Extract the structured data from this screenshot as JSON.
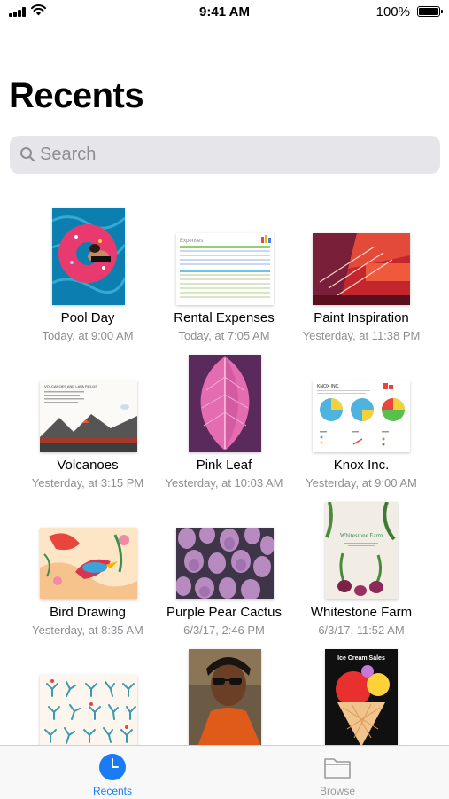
{
  "status_bar": {
    "time": "9:41 AM",
    "battery_percent": "100%"
  },
  "page_title": "Recents",
  "search": {
    "placeholder": "Search"
  },
  "documents": [
    {
      "name": "Pool Day",
      "date": "Today, at 9:00 AM"
    },
    {
      "name": "Rental Expenses",
      "date": "Today, at 7:05 AM",
      "thumb_title": "Expenses"
    },
    {
      "name": "Paint Inspiration",
      "date": "Yesterday, at 11:38 PM"
    },
    {
      "name": "Volcanoes",
      "date": "Yesterday, at 3:15 PM",
      "thumb_title": "VOLCANOES AND LAVA FIELDS"
    },
    {
      "name": "Pink Leaf",
      "date": "Yesterday, at 10:03 AM"
    },
    {
      "name": "Knox Inc.",
      "date": "Yesterday, at 9:00 AM",
      "thumb_title": "KNOX INC."
    },
    {
      "name": "Bird Drawing",
      "date": "Yesterday, at 8:35 AM"
    },
    {
      "name": "Purple Pear Cactus",
      "date": "6/3/17, 2:46 PM"
    },
    {
      "name": "Whitestone Farm",
      "date": "6/3/17, 11:52 AM",
      "thumb_title": "Whitestone Farm"
    },
    {
      "name": "",
      "date": ""
    },
    {
      "name": "",
      "date": ""
    },
    {
      "name": "",
      "date": "",
      "thumb_title": "Ice Cream Sales"
    }
  ],
  "tab_bar": {
    "recents_label": "Recents",
    "browse_label": "Browse",
    "active": "recents",
    "active_color": "#1a7cf5",
    "inactive_color": "#9b9b9b"
  },
  "icons": [
    "signal-icon",
    "wifi-icon",
    "battery-icon",
    "search-icon",
    "clock-icon",
    "folder-icon"
  ]
}
